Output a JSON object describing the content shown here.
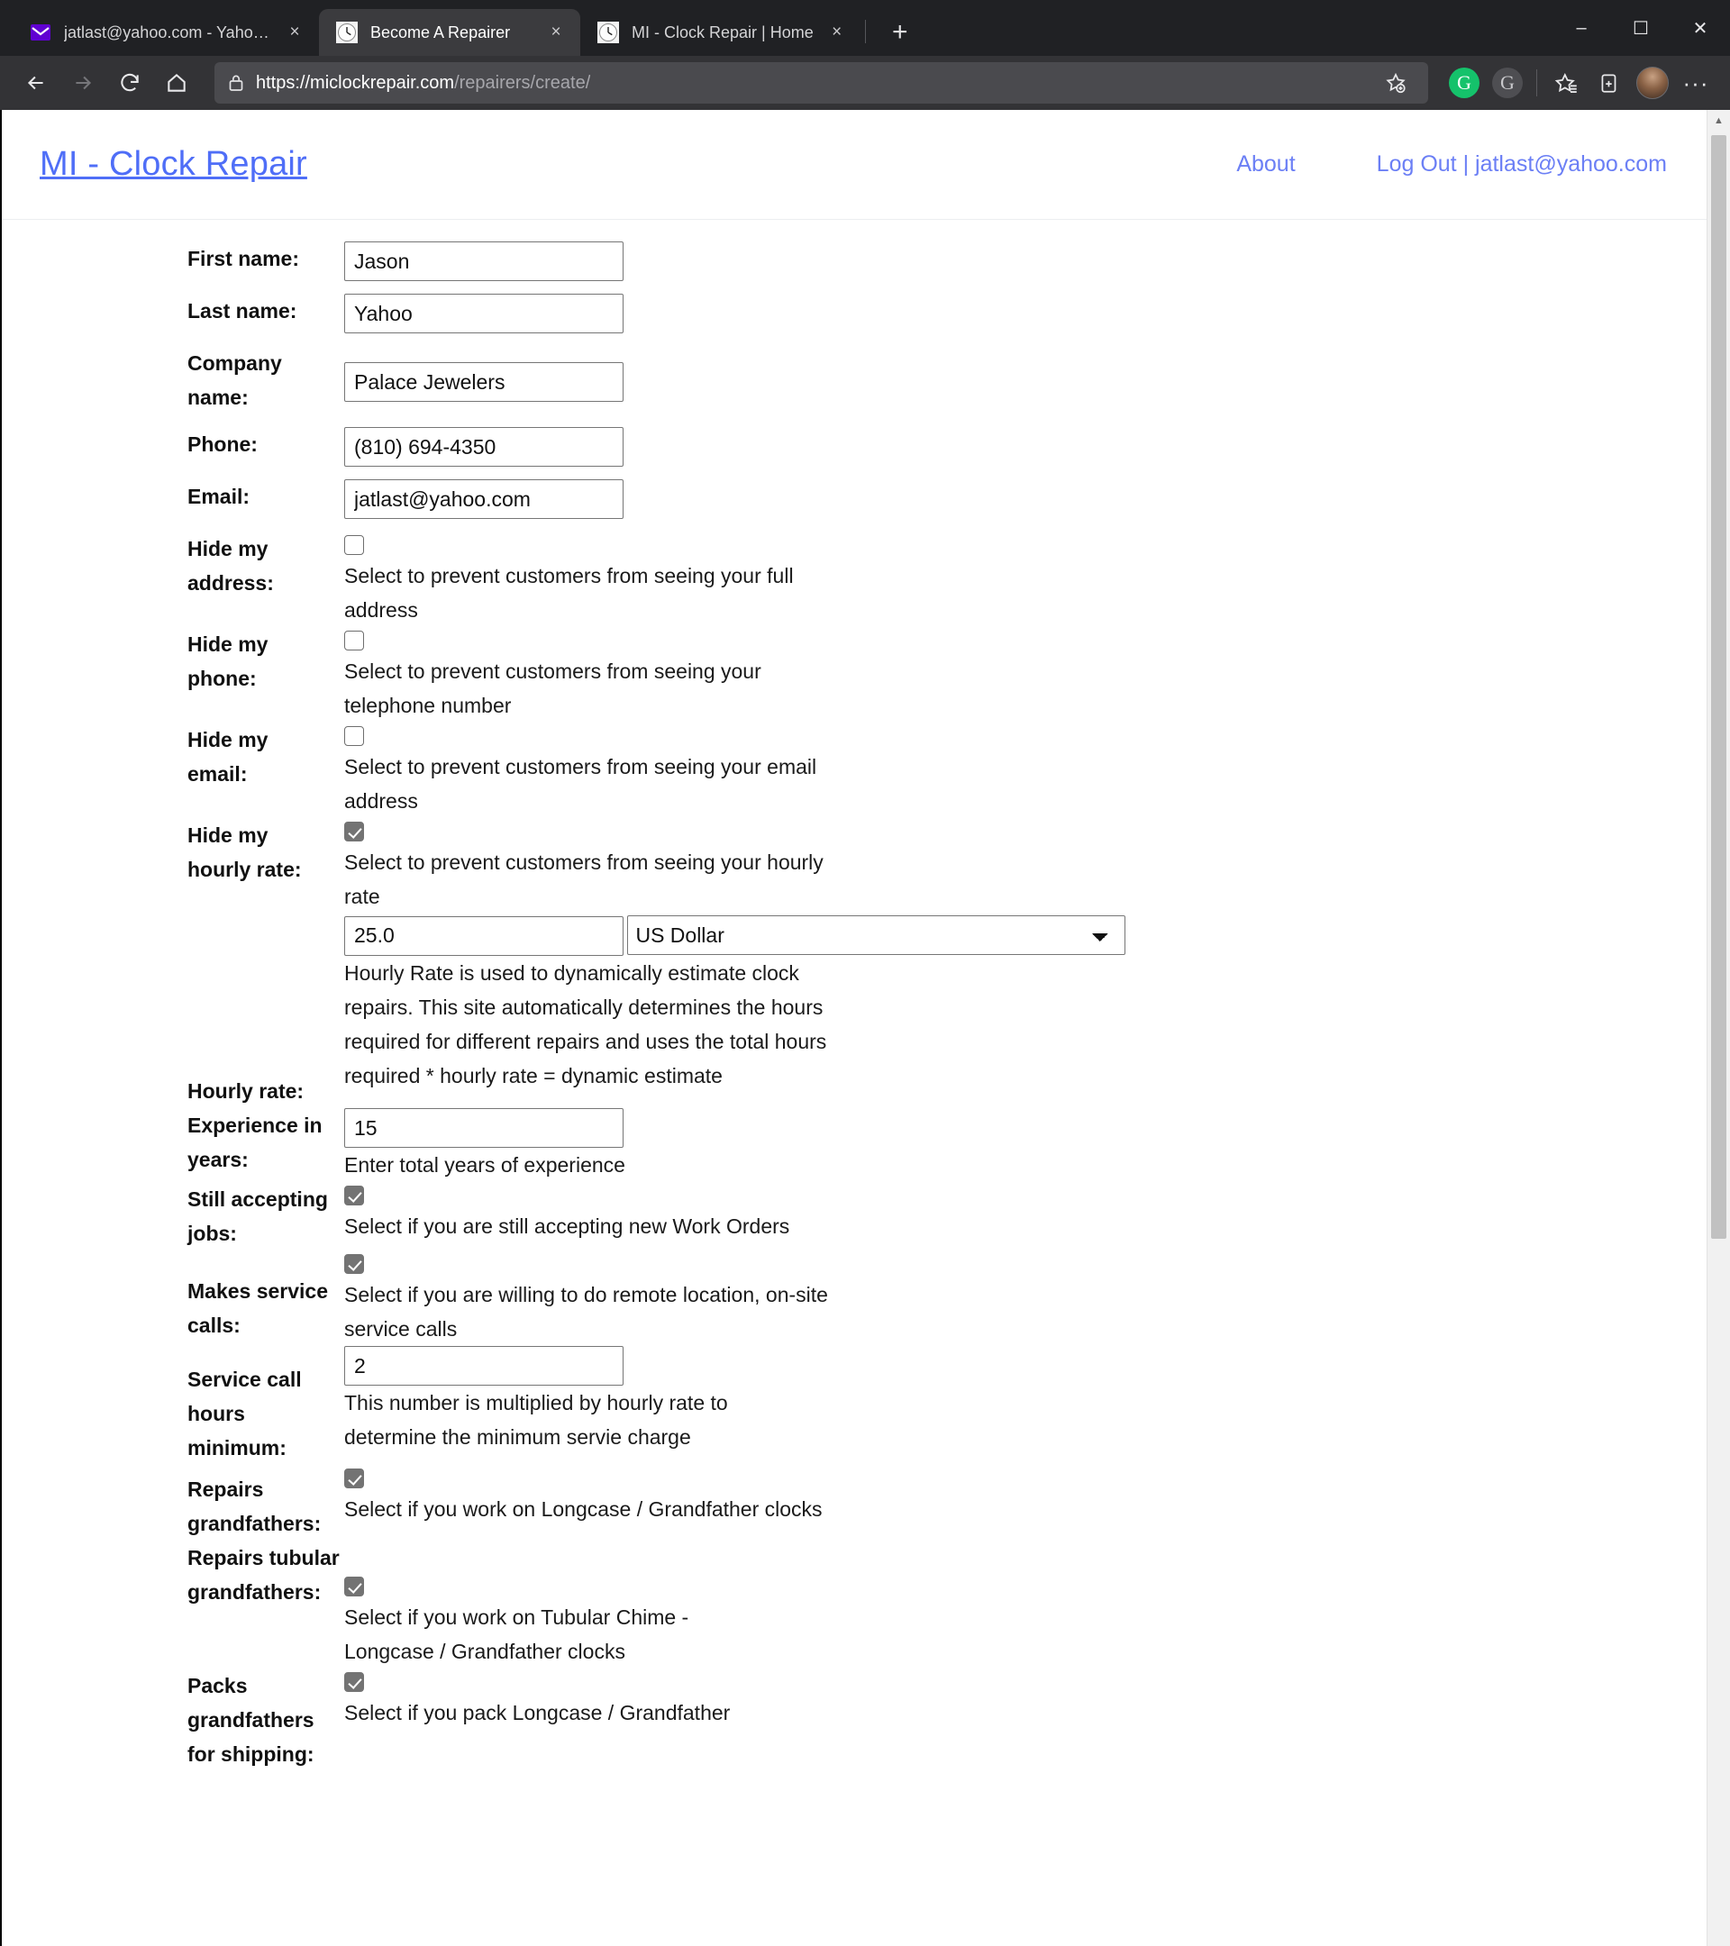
{
  "browser": {
    "tabs": [
      {
        "title": "jatlast@yahoo.com - Yahoo Mail",
        "favicon": "mail-icon",
        "active": false,
        "close": "×"
      },
      {
        "title": "Become A Repairer",
        "favicon": "clock-icon",
        "active": true,
        "close": "×"
      },
      {
        "title": "MI - Clock Repair | Home",
        "favicon": "clock-icon",
        "active": false,
        "close": "×"
      }
    ],
    "new_tab_label": "+",
    "window_controls": {
      "minimize": "–",
      "maximize": "☐",
      "close": "✕"
    },
    "nav": {
      "back": "←",
      "forward": "→",
      "reload": "↻",
      "home": "⌂"
    },
    "omnibox": {
      "lock_icon": "lock-icon",
      "url_domain": "https://miclockrepair.com",
      "url_path": "/repairers/create/",
      "favorite_icon": "add-favorite-icon"
    },
    "toolbar_icons": [
      "grammarly-icon",
      "grammarly-secondary-icon",
      "collections-favorites-icon",
      "collections-icon",
      "profile-avatar",
      "settings-more-icon"
    ],
    "more_label": "···"
  },
  "site": {
    "brand": "MI - Clock Repair",
    "nav": [
      {
        "label": "About"
      },
      {
        "label": "Log Out | jatlast@yahoo.com"
      }
    ]
  },
  "form": {
    "first_name": {
      "label": "First name:",
      "value": "Jason"
    },
    "last_name": {
      "label": "Last name:",
      "value": "Yahoo"
    },
    "company_name": {
      "label": "Company name:",
      "value": "Palace Jewelers"
    },
    "phone": {
      "label": "Phone:",
      "value": "(810) 694-4350"
    },
    "email": {
      "label": "Email:",
      "value": "jatlast@yahoo.com"
    },
    "hide_address": {
      "label": "Hide my address:",
      "checked": false,
      "help": "Select to prevent customers from seeing your full address"
    },
    "hide_phone": {
      "label": "Hide my phone:",
      "checked": false,
      "help": "Select to prevent customers from seeing your telephone number"
    },
    "hide_email": {
      "label": "Hide my email:",
      "checked": false,
      "help": "Select to prevent customers from seeing your email address"
    },
    "hide_hourly_rate": {
      "label": "Hide my hourly rate:",
      "checked": true,
      "help": "Select to prevent customers from seeing your hourly rate"
    },
    "hourly_rate": {
      "label": "Hourly rate:",
      "value": "25.0",
      "currency_selected": "US Dollar",
      "currency_options": [
        "US Dollar"
      ],
      "help": "Hourly Rate is used to dynamically estimate clock repairs. This site automatically determines the hours required for different repairs and uses the total hours required * hourly rate = dynamic estimate"
    },
    "experience_years": {
      "label": "Experience in years:",
      "value": "15",
      "help": "Enter total years of experience"
    },
    "still_accepting_jobs": {
      "label": "Still accepting jobs:",
      "checked": true,
      "help": "Select if you are still accepting new Work Orders"
    },
    "makes_service_calls": {
      "label": "Makes service calls:",
      "checked": true,
      "help": "Select if you are willing to do remote location, on-site service calls"
    },
    "service_call_hours_minimum": {
      "label": "Service call hours minimum:",
      "value": "2",
      "help": "This number is multiplied by hourly rate to determine the minimum servie charge"
    },
    "repairs_grandfathers": {
      "label": "Repairs grandfathers:",
      "checked": true,
      "help": "Select if you work on Longcase / Grandfather clocks"
    },
    "repairs_tubular_grandfathers": {
      "label": "Repairs tubular grandfathers:",
      "checked": true,
      "help": "Select if you work on Tubular Chime - Longcase / Grandfather clocks"
    },
    "packs_grandfathers": {
      "label": "Packs grandfathers for shipping:",
      "checked": true,
      "help": "Select if you pack Longcase / Grandfather"
    }
  },
  "scrollbar": {
    "up_arrow": "▲",
    "down_arrow": "▼"
  },
  "colors": {
    "brand": "#4f6ef7",
    "link": "#6b7ff5",
    "checkbox_checked": "#737373"
  }
}
